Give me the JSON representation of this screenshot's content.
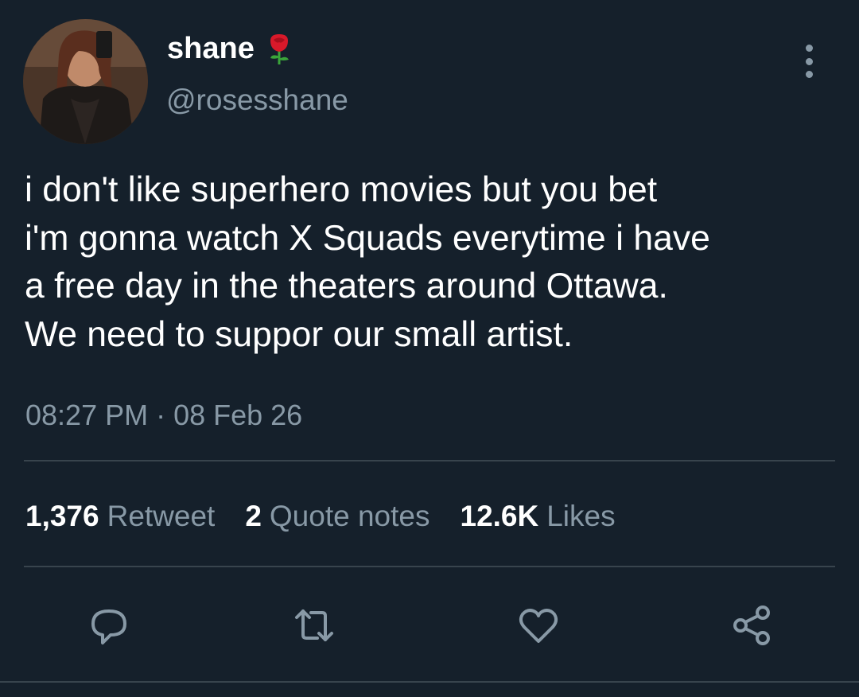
{
  "user": {
    "name": "shane",
    "handle": "@rosesshane",
    "name_emoji": "rose-icon"
  },
  "tweet": {
    "text": "i don't like superhero movies but you bet\ni'm gonna watch X Squads everytime i have\na free day in the theaters around Ottawa.\nWe need to suppor our small artist.",
    "timestamp": "08:27 PM · 08 Feb 26"
  },
  "stats": {
    "retweets": {
      "count": "1,376",
      "label": "Retweet"
    },
    "quotes": {
      "count": "2",
      "label": "Quote notes"
    },
    "likes": {
      "count": "12.6K",
      "label": "Likes"
    }
  },
  "actions": [
    "reply-icon",
    "retweet-icon",
    "like-icon",
    "share-icon"
  ],
  "colors": {
    "background": "#15202b",
    "secondary_text": "#8899a6",
    "divider": "#38444d"
  }
}
